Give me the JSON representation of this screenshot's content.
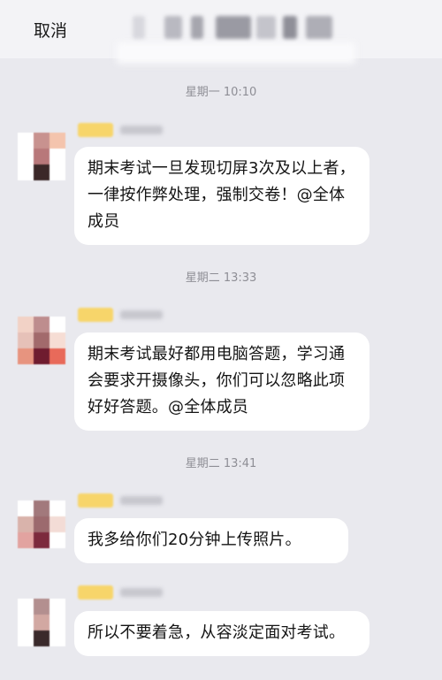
{
  "header": {
    "cancel_label": "取消",
    "title_obscured": true
  },
  "messages": [
    {
      "timestamp": "星期一 10:10",
      "text": "期末考试一旦发现切屏3次及以上者，一律按作弊处理，强制交卷！@全体成员",
      "sender_obscured": true,
      "avatar_colors": [
        "#ffffff",
        "#c8928f",
        "#f4c4ad",
        "#ffffff",
        "#b8787a",
        "#ffffff",
        "#ffffff",
        "#3b2828",
        "#ffffff"
      ]
    },
    {
      "timestamp": "星期二 13:33",
      "text": "期末考试最好都用电脑答题，学习通会要求开摄像头，你们可以忽略此项好好答题。@全体成员",
      "sender_obscured": true,
      "avatar_colors": [
        "#f2d2c6",
        "#be8d8e",
        "#ffffff",
        "#e6c1b8",
        "#a26a6c",
        "#f6ddd4",
        "#e7947f",
        "#6f1c2f",
        "#e86a5a"
      ]
    },
    {
      "timestamp": "星期二 13:41",
      "text": "我多给你们20分钟上传照片。",
      "sender_obscured": true,
      "avatar_colors": [
        "#ffffff",
        "#a2797c",
        "#ffffff",
        "#d9b3ab",
        "#9c6a6e",
        "#f3dcd6",
        "#e2a3a0",
        "#7c2a3d",
        "#ffffff"
      ]
    },
    {
      "timestamp": "",
      "text": "所以不要着急，从容淡定面对考试。",
      "sender_obscured": true,
      "avatar_colors": [
        "#ffffff",
        "#b38f8f",
        "#ffffff",
        "#ffffff",
        "#d2a8a2",
        "#ffffff",
        "#ffffff",
        "#3a2a2b",
        "#ffffff"
      ]
    }
  ]
}
